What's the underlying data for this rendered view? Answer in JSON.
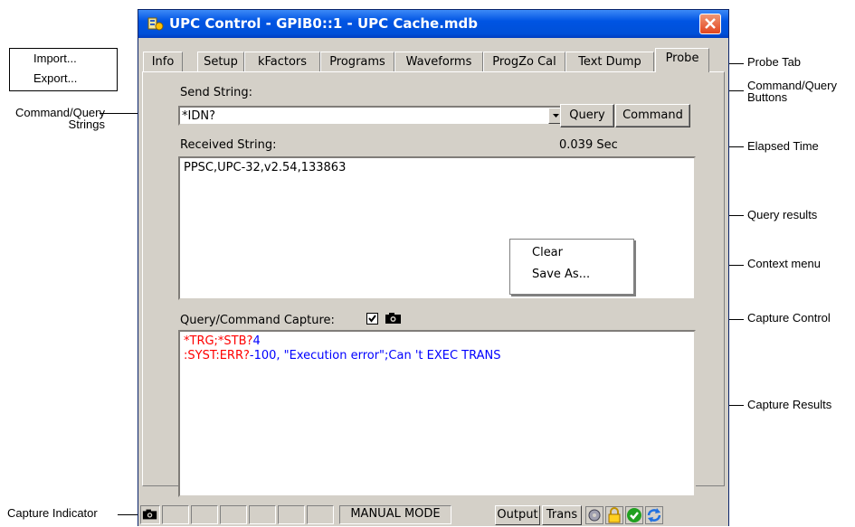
{
  "window": {
    "title": "UPC Control - GPIB0::1 - UPC Cache.mdb",
    "icons": {
      "app": "app-icon",
      "close": "close-icon"
    }
  },
  "menu_popup": {
    "import_label": "Import...",
    "export_label": "Export..."
  },
  "tabs": [
    {
      "label": "Info"
    },
    {
      "label": "Setup"
    },
    {
      "label": "kFactors"
    },
    {
      "label": "Programs"
    },
    {
      "label": "Waveforms"
    },
    {
      "label": "ProgZo Cal"
    },
    {
      "label": "Text Dump"
    },
    {
      "label": "Probe",
      "active": true
    }
  ],
  "probe": {
    "send_label": "Send String:",
    "send_value": "*IDN?",
    "query_button": "Query",
    "command_button": "Command",
    "received_label": "Received String:",
    "elapsed": "0.039 Sec",
    "received_value": "PPSC,UPC-32,v2.54,133863",
    "context_menu": {
      "clear": "Clear",
      "save_as": "Save As..."
    },
    "capture_label": "Query/Command Capture:",
    "capture_checked": true,
    "capture_lines": [
      {
        "cmd": "*TRG;*STB?",
        "resp": "4"
      },
      {
        "cmd": ":SYST:ERR?",
        "resp": "-100, \"Execution error\";Can 't EXEC TRANS"
      }
    ],
    "colors": {
      "command": "#ff0000",
      "response": "#0000ff"
    }
  },
  "statusbar": {
    "mode": "MANUAL MODE",
    "output_button": "Output",
    "trans_button": "Trans",
    "icons": [
      "camera-icon",
      "disk-icon",
      "lock-icon",
      "check-icon",
      "refresh-icon"
    ]
  },
  "callouts": {
    "probe_tab": "Probe Tab",
    "command_query_buttons": "Command/Query\nButtons",
    "command_query_strings": "Command/Query\nStrings",
    "elapsed_time": "Elapsed Time",
    "query_results": "Query results",
    "context_menu": "Context menu",
    "capture_control": "Capture Control",
    "capture_results": "Capture Results",
    "capture_indicator": "Capture Indicator"
  }
}
